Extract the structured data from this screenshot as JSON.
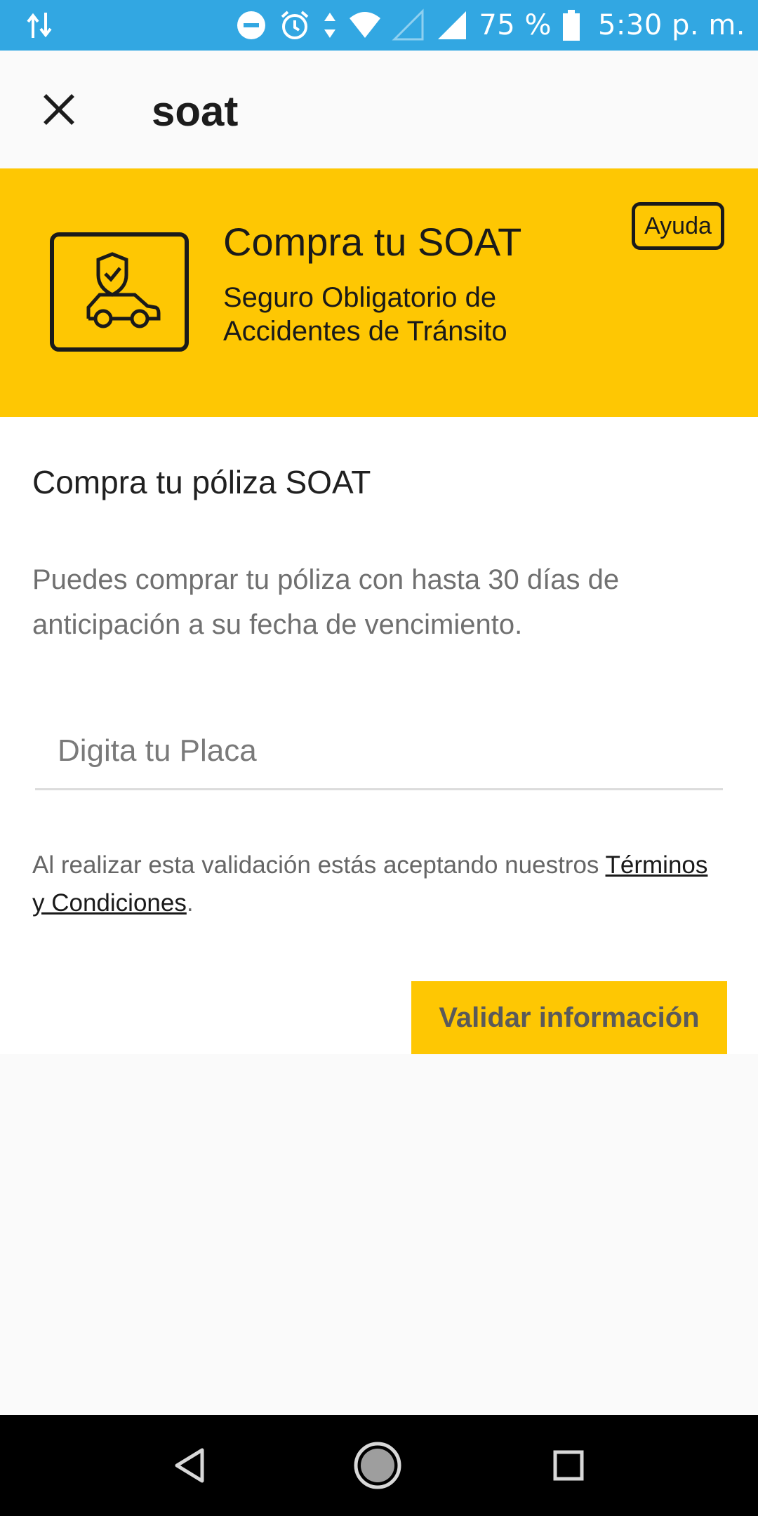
{
  "status_bar": {
    "battery_percent": "75 %",
    "time": "5:30 p. m.",
    "icons": [
      "data-transfer-icon",
      "do-not-disturb-icon",
      "alarm-icon",
      "wifi-icon",
      "signal-empty-icon",
      "signal-icon",
      "battery-icon"
    ]
  },
  "app_bar": {
    "title": "soat",
    "close_icon": "close-icon"
  },
  "banner": {
    "title": "Compra tu SOAT",
    "subtitle": "Seguro Obligatorio de Accidentes de Tránsito",
    "help_label": "Ayuda",
    "icon": "insured-car-icon",
    "background_color": "#fec703"
  },
  "content": {
    "section_title": "Compra tu póliza SOAT",
    "description": "Puedes comprar tu póliza con hasta 30 días de anticipación a su fecha de vencimiento.",
    "plate_input": {
      "placeholder": "Digita tu Placa",
      "value": ""
    },
    "terms_prefix": "Al realizar esta validación estás aceptando nuestros ",
    "terms_link": "Términos y Condiciones",
    "terms_suffix": ".",
    "validate_label": "Validar información"
  },
  "nav_bar": {
    "back_icon": "back-triangle-icon",
    "home_icon": "home-circle-icon",
    "recents_icon": "recents-square-icon"
  },
  "colors": {
    "status_bar": "#32a7e2",
    "accent": "#fec703"
  }
}
